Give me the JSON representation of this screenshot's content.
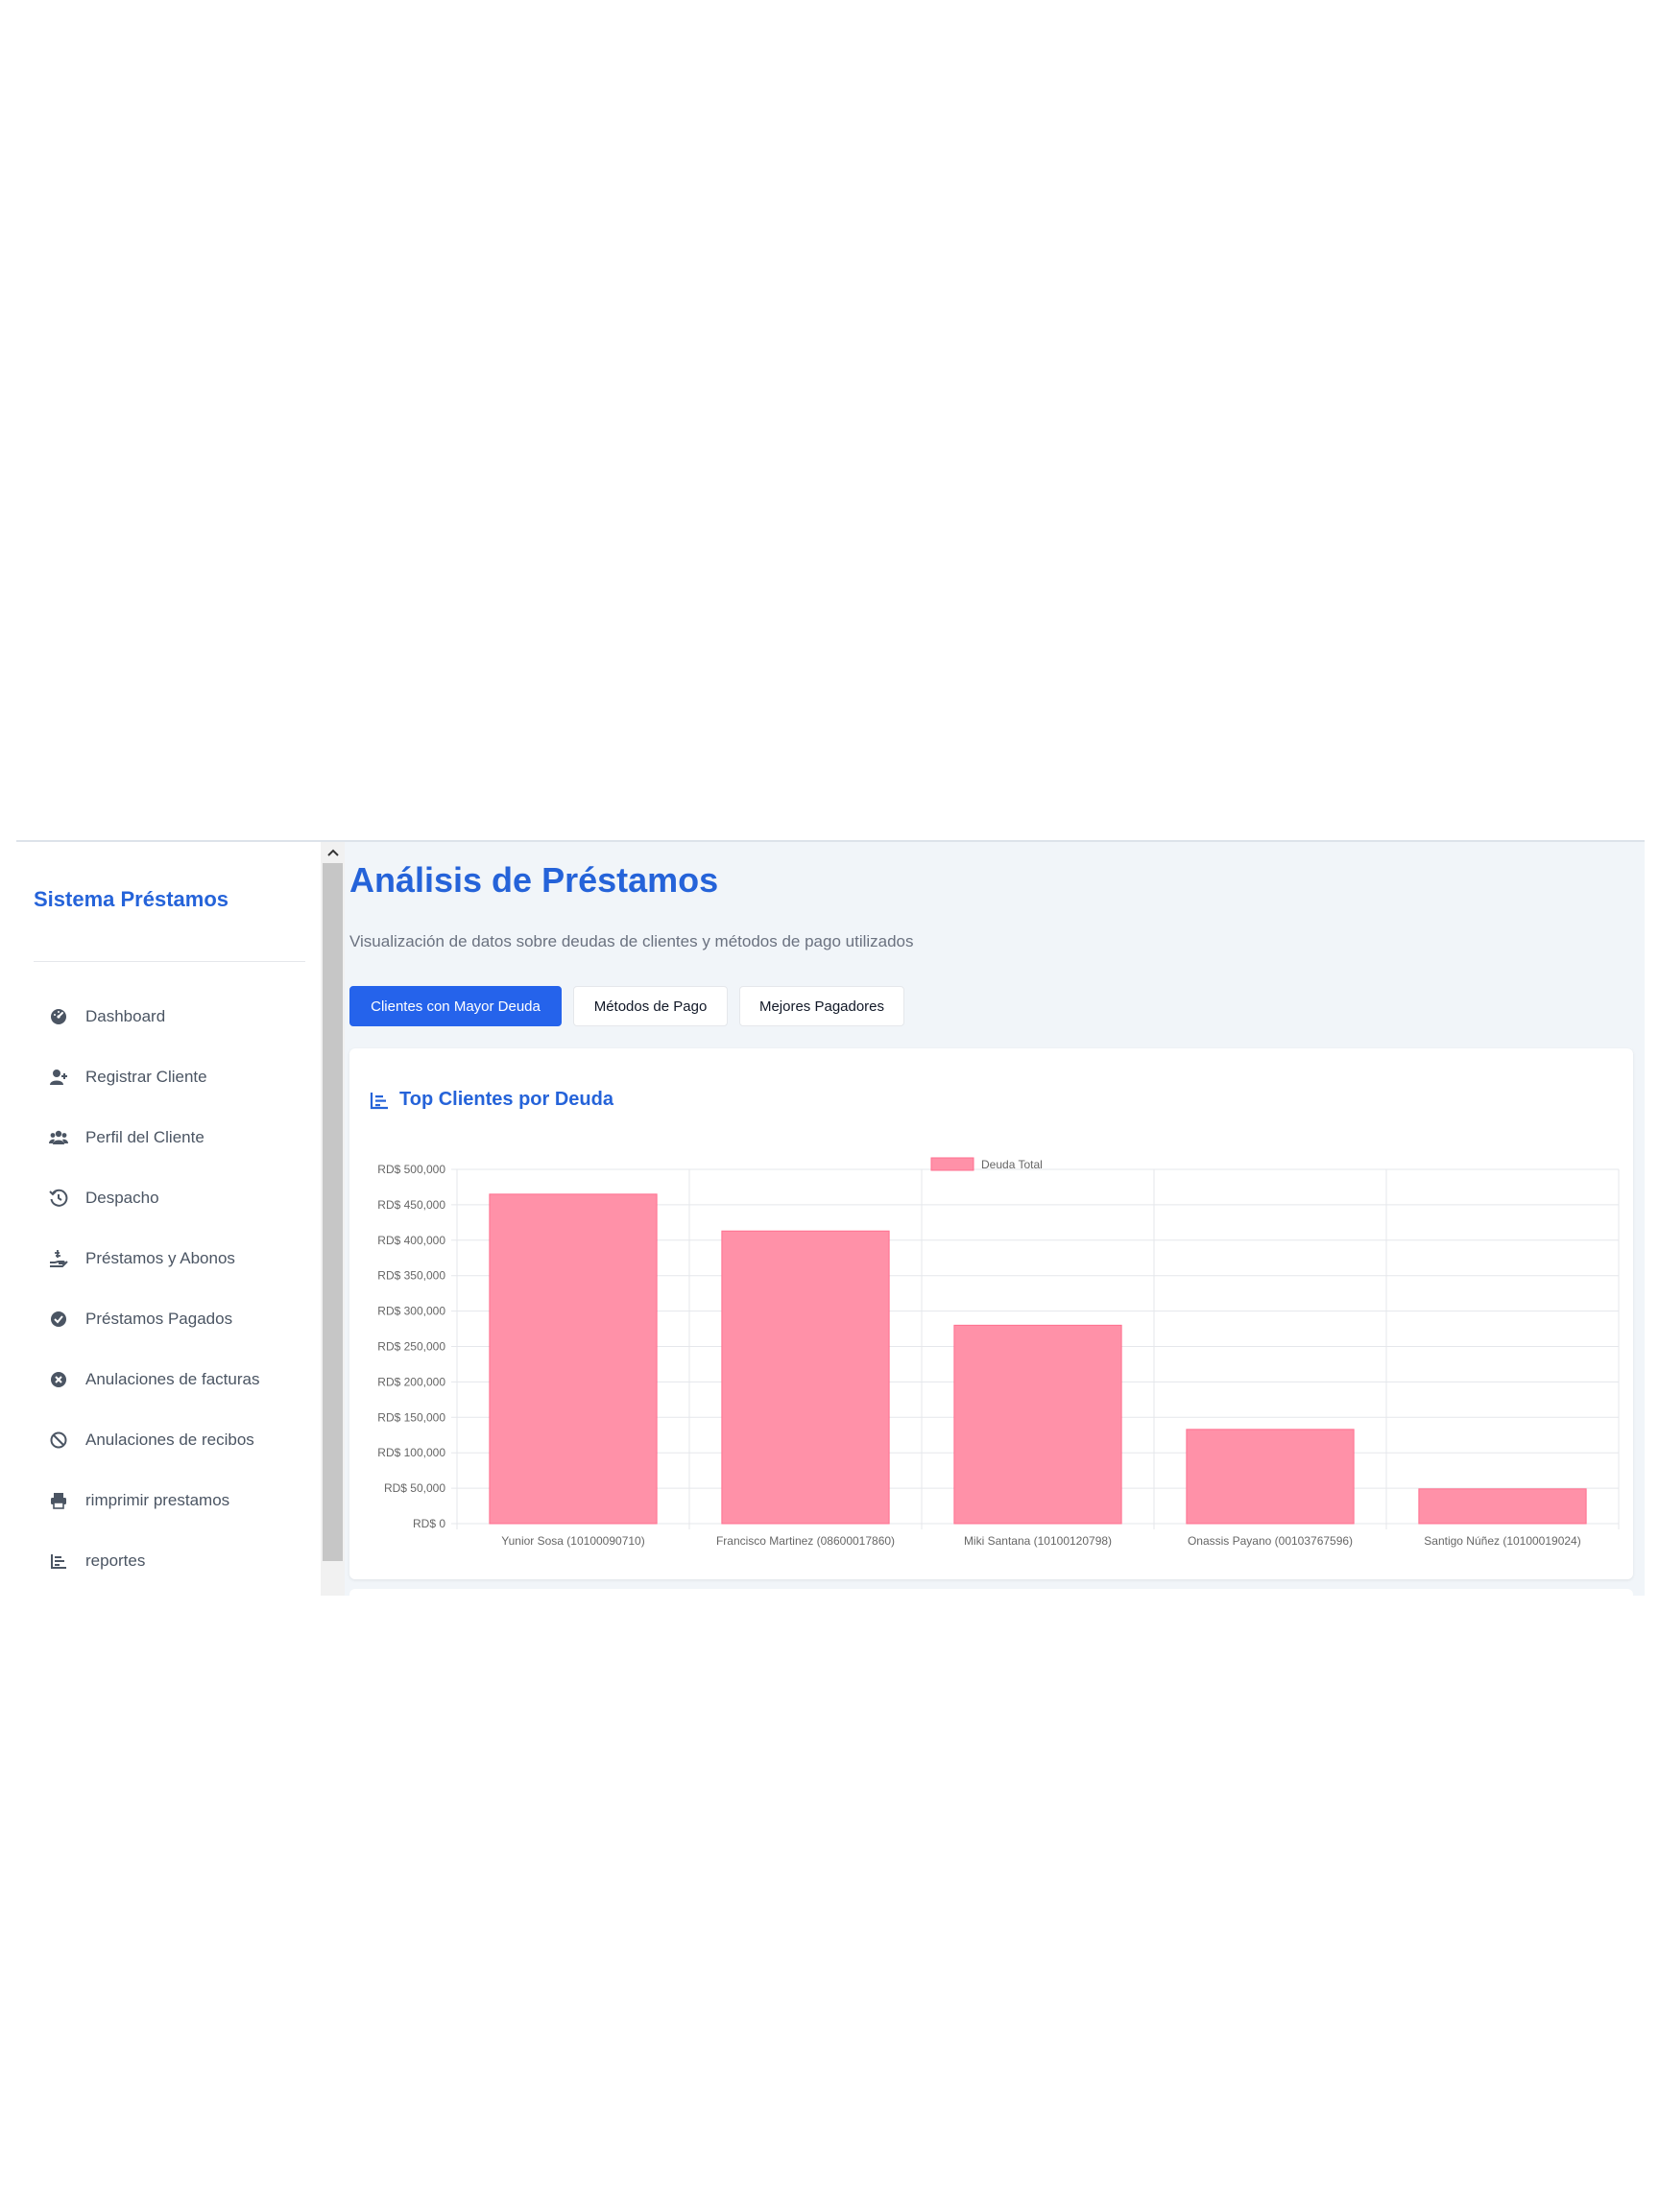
{
  "sidebar": {
    "brand": "Sistema Préstamos",
    "items": [
      {
        "label": "Dashboard",
        "icon": "dashboard-icon"
      },
      {
        "label": "Registrar Cliente",
        "icon": "user-plus-icon"
      },
      {
        "label": "Perfil del Cliente",
        "icon": "users-icon"
      },
      {
        "label": "Despacho",
        "icon": "history-icon"
      },
      {
        "label": "Préstamos y Abonos",
        "icon": "hand-holding-usd-icon"
      },
      {
        "label": "Préstamos Pagados",
        "icon": "check-circle-icon"
      },
      {
        "label": "Anulaciones de facturas",
        "icon": "times-circle-icon"
      },
      {
        "label": "Anulaciones de recibos",
        "icon": "ban-icon"
      },
      {
        "label": "rimprimir prestamos",
        "icon": "print-icon"
      },
      {
        "label": "reportes",
        "icon": "chart-bar-icon"
      }
    ]
  },
  "main": {
    "title": "Análisis de Préstamos",
    "subtitle": "Visualización de datos sobre deudas de clientes y métodos de pago utilizados",
    "tabs": [
      {
        "label": "Clientes con Mayor Deuda",
        "active": true
      },
      {
        "label": "Métodos de Pago",
        "active": false
      },
      {
        "label": "Mejores Pagadores",
        "active": false
      }
    ],
    "card_title": "Top Clientes por Deuda"
  },
  "colors": {
    "accent": "#2563eb",
    "title": "#2563d9",
    "bar_fill": "#ff91a8",
    "bar_border": "#ff6f8f",
    "grid": "#e5e7eb"
  },
  "chart_data": {
    "type": "bar",
    "categories": [
      "Yunior  Sosa (10100090710)",
      "Francisco  Martinez (08600017860)",
      "Miki Santana (10100120798)",
      "Onassis Payano (00103767596)",
      "Santigo Núñez  (10100019024)"
    ],
    "series": [
      {
        "name": "Deuda Total",
        "values": [
          465000,
          413000,
          280000,
          133000,
          49000
        ]
      }
    ],
    "ylim": [
      0,
      500000
    ],
    "y_ticks": [
      0,
      50000,
      100000,
      150000,
      200000,
      250000,
      300000,
      350000,
      400000,
      450000,
      500000
    ],
    "y_tick_labels": [
      "RD$ 0",
      "RD$ 50,000",
      "RD$ 100,000",
      "RD$ 150,000",
      "RD$ 200,000",
      "RD$ 250,000",
      "RD$ 300,000",
      "RD$ 350,000",
      "RD$ 400,000",
      "RD$ 450,000",
      "RD$ 500,000"
    ],
    "legend_position": "top-center",
    "grid": true
  }
}
